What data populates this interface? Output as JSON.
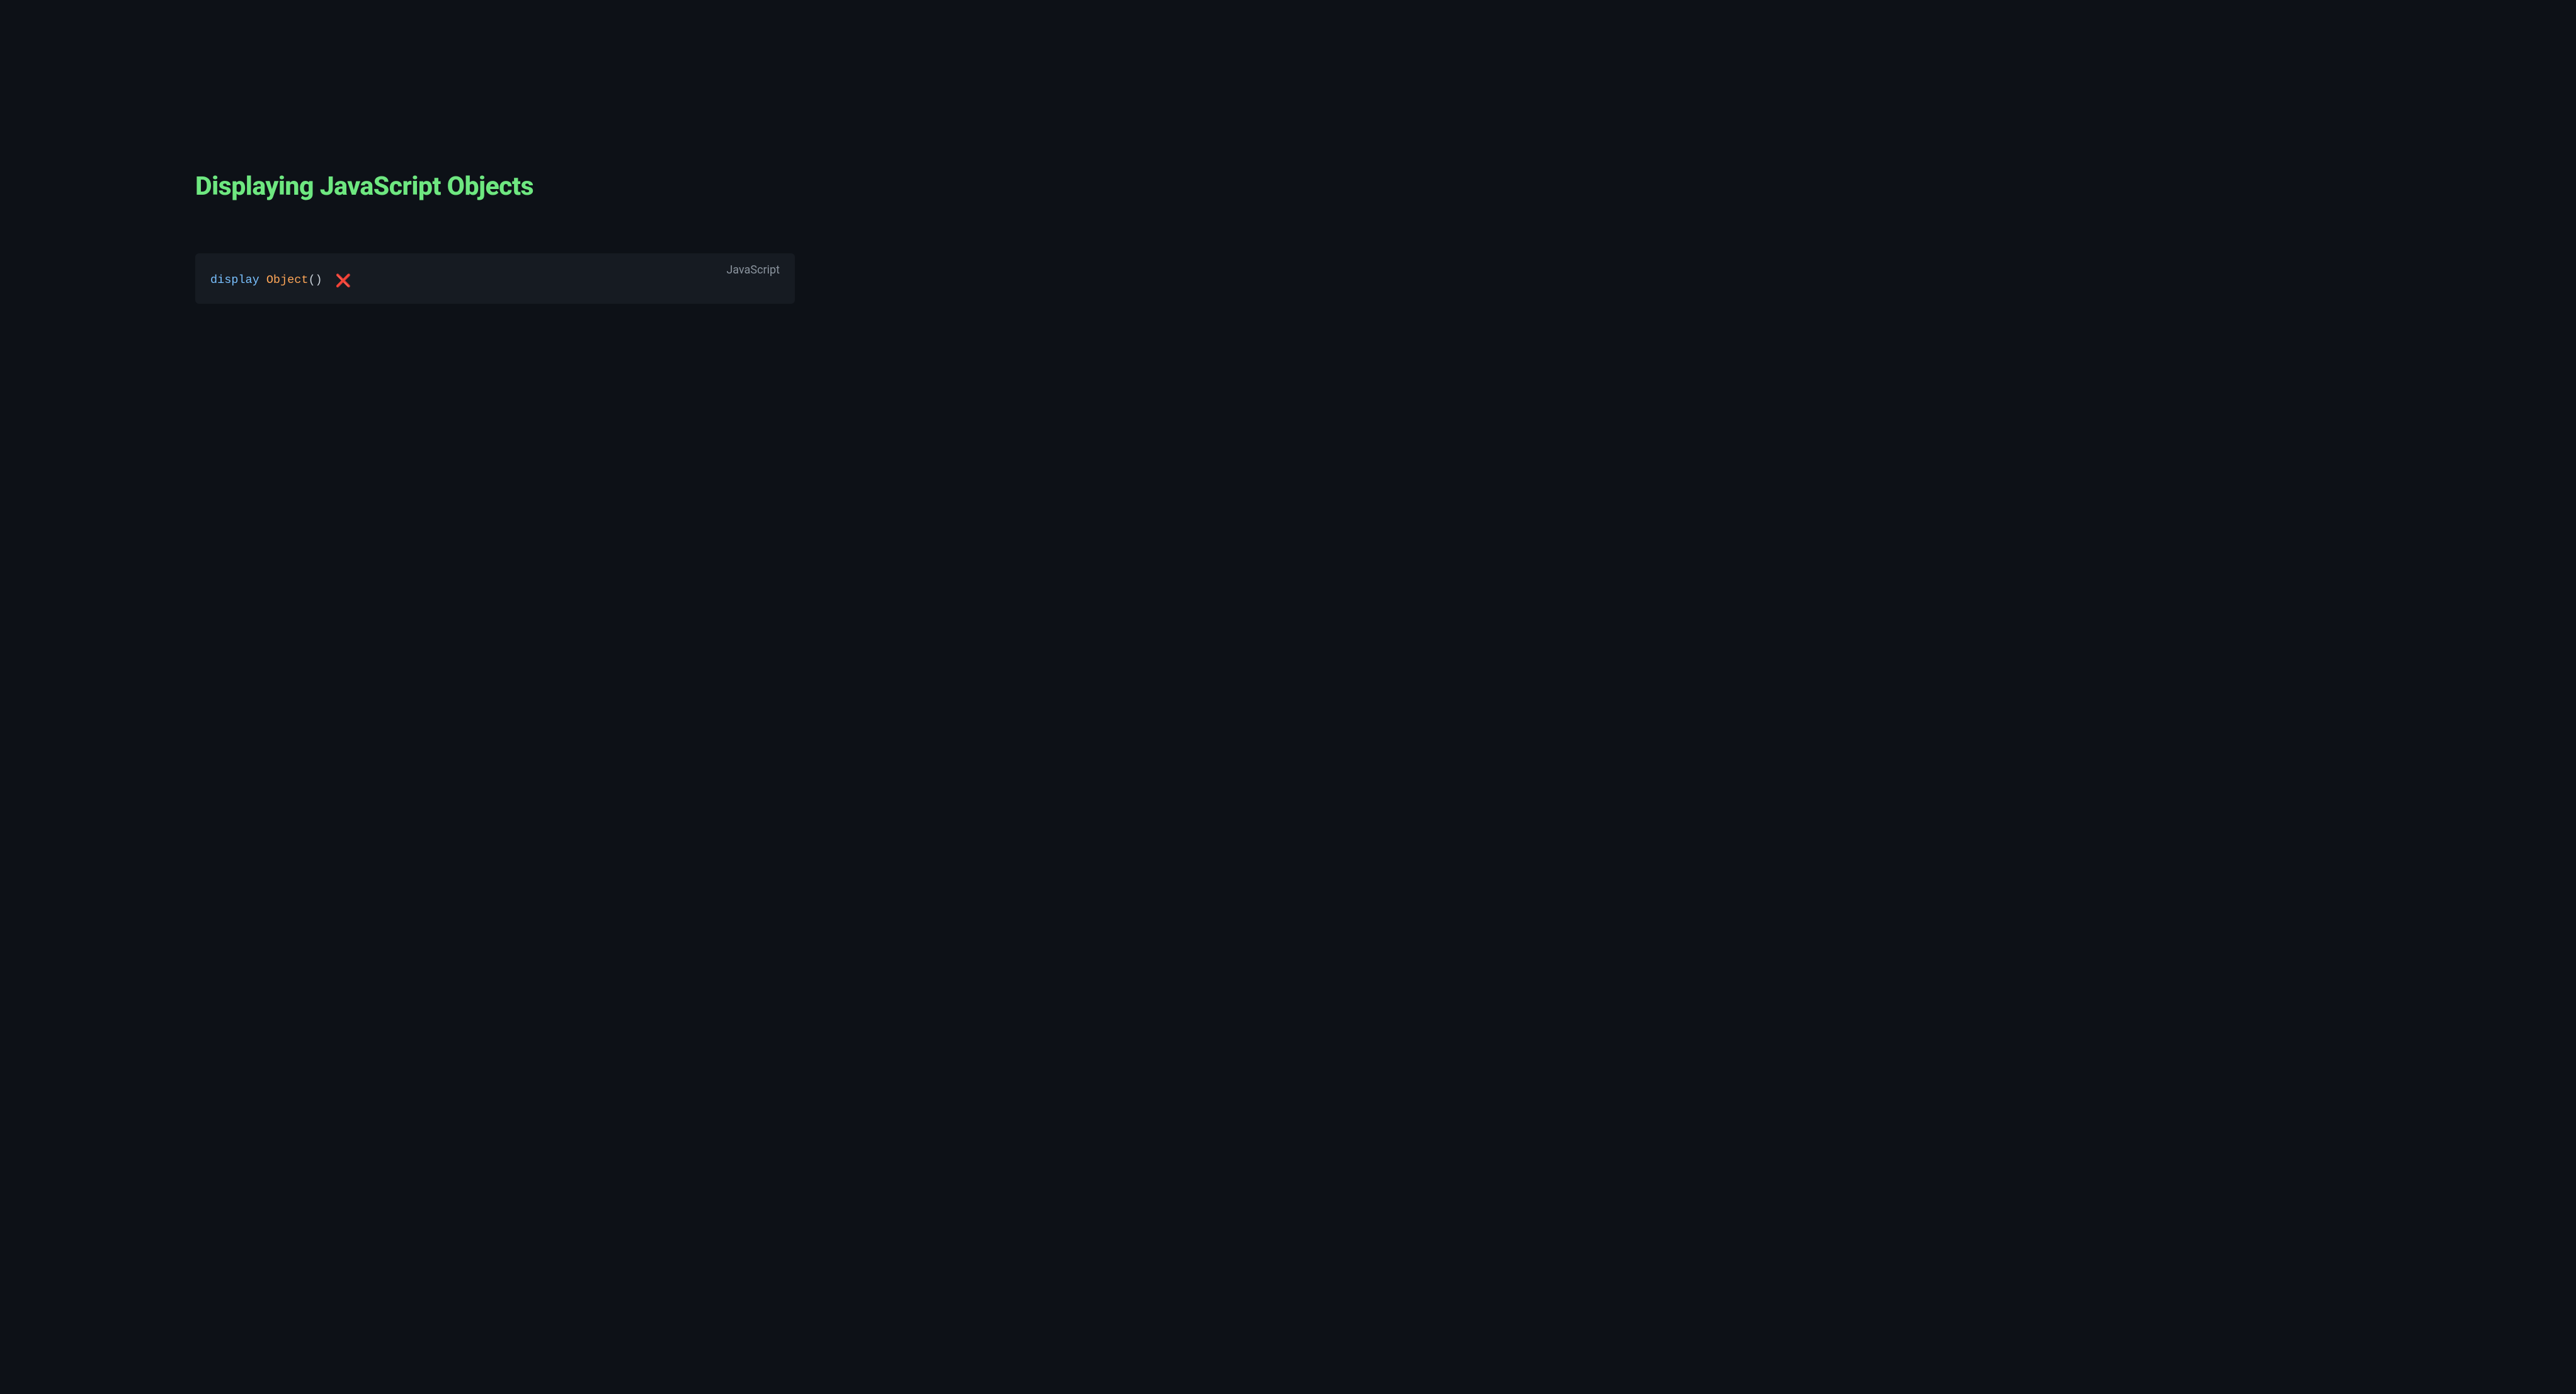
{
  "heading": "Displaying JavaScript Objects",
  "code_block": {
    "language_label": "JavaScript",
    "tokens": {
      "keyword": "display",
      "space1": " ",
      "class": "Object",
      "parens": "()",
      "space2": " "
    },
    "cross_emoji": "❌"
  }
}
